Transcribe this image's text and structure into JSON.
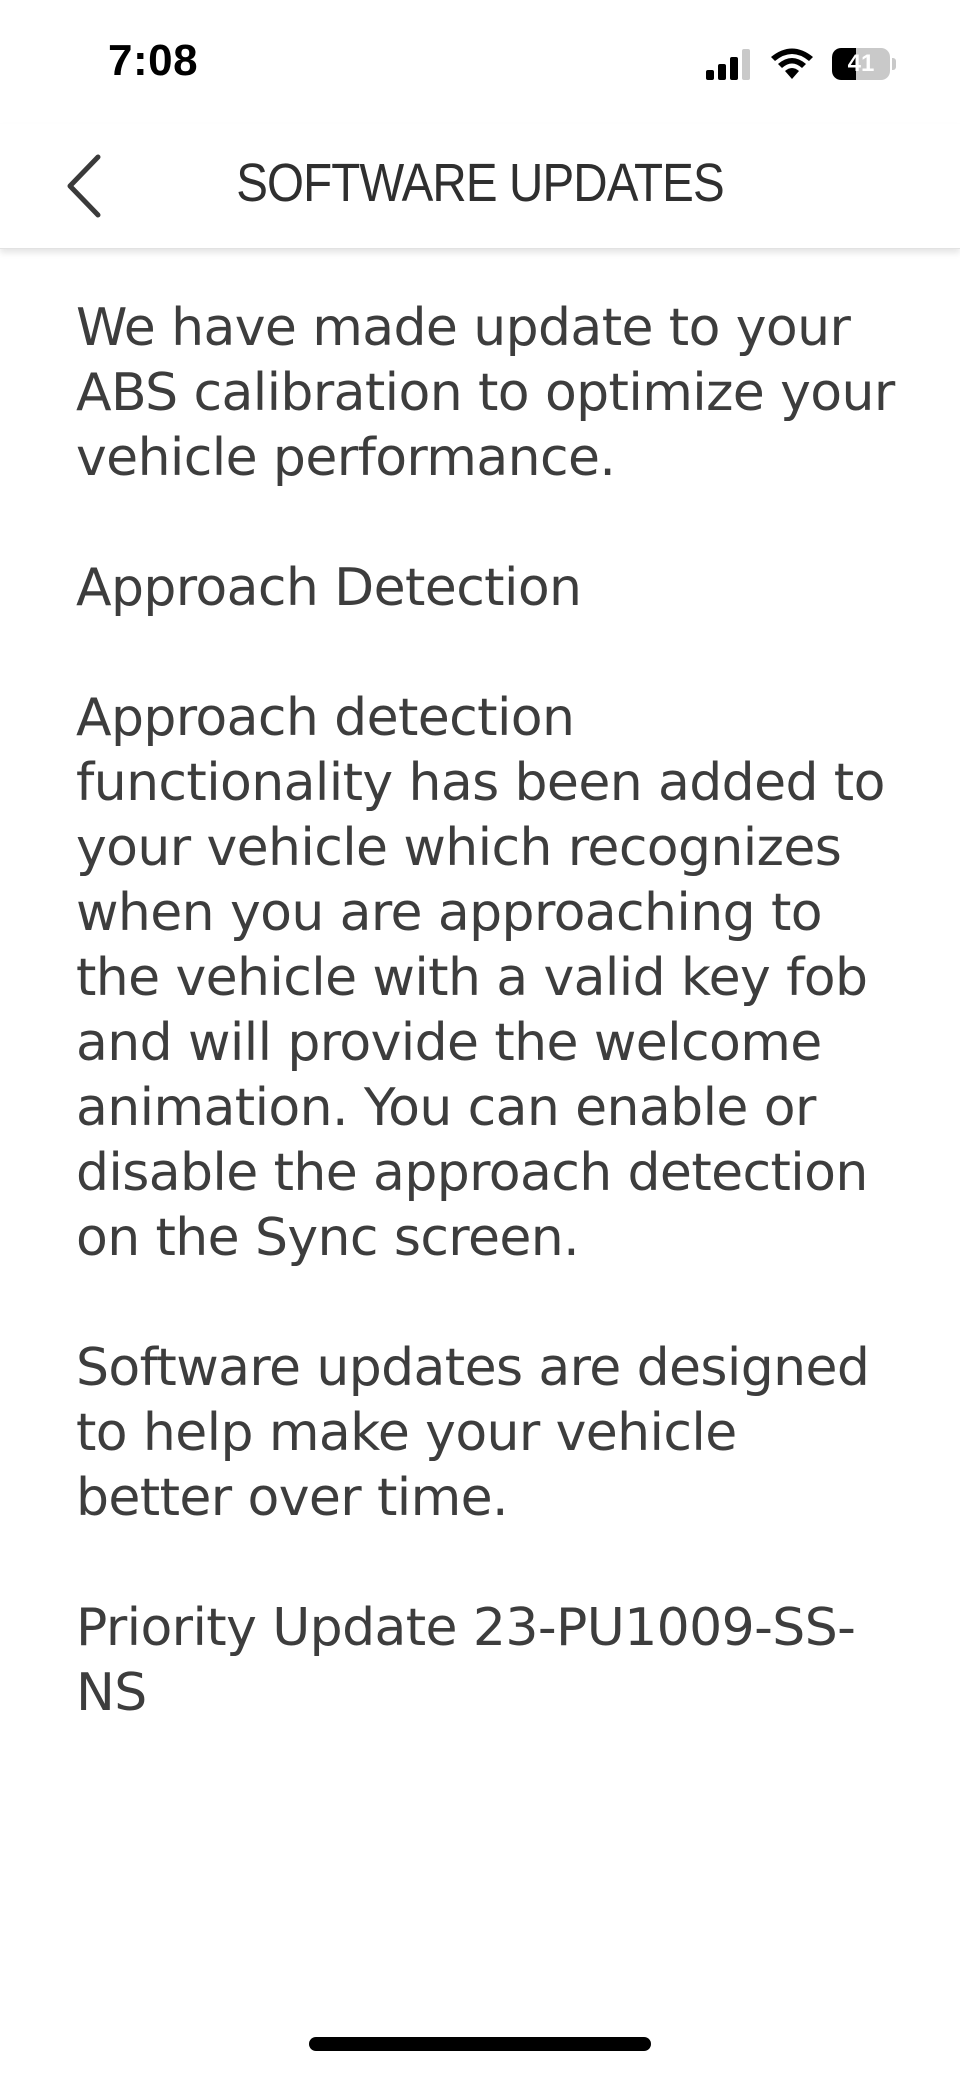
{
  "status_bar": {
    "time": "7:08",
    "battery_level": "41",
    "battery_percent": 41,
    "signal_bars_active": 3,
    "signal_bars_total": 4
  },
  "header": {
    "title": "SOFTWARE UPDATES",
    "back_icon": "chevron-left-icon"
  },
  "content": {
    "paragraphs": [
      "We have made update to your ABS calibration to optimize your vehicle performance.",
      "Approach Detection",
      "Approach detection functionality has been added to your vehicle which recognizes when you are approaching to the vehicle with a valid key fob and will provide the welcome animation. You can enable or disable the approach detection on the Sync screen.",
      "Software updates are designed to help make your vehicle better over time.",
      "Priority Update 23-PU1009-SS-NS"
    ]
  },
  "colors": {
    "text": "#3d3d3d",
    "background": "#ffffff",
    "title": "#2f2f2f"
  }
}
